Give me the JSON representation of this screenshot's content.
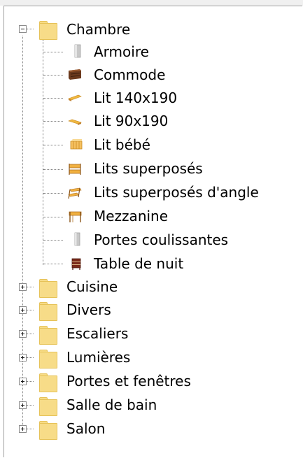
{
  "tree": {
    "root": {
      "label": "Chambre",
      "expanded": true,
      "children": [
        {
          "label": "Armoire",
          "icon": "armoire-icon"
        },
        {
          "label": "Commode",
          "icon": "commode-icon"
        },
        {
          "label": "Lit 140x190",
          "icon": "bed-icon"
        },
        {
          "label": "Lit 90x190",
          "icon": "bed-icon"
        },
        {
          "label": "Lit bébé",
          "icon": "crib-icon"
        },
        {
          "label": "Lits superposés",
          "icon": "bunk-bed-icon"
        },
        {
          "label": "Lits superposés d'angle",
          "icon": "corner-bunk-bed-icon"
        },
        {
          "label": "Mezzanine",
          "icon": "mezzanine-icon"
        },
        {
          "label": "Portes coulissantes",
          "icon": "sliding-door-icon"
        },
        {
          "label": "Table de nuit",
          "icon": "nightstand-icon"
        }
      ]
    },
    "categories": [
      {
        "label": "Cuisine",
        "expanded": false
      },
      {
        "label": "Divers",
        "expanded": false
      },
      {
        "label": "Escaliers",
        "expanded": false
      },
      {
        "label": "Lumières",
        "expanded": false
      },
      {
        "label": "Portes et fenêtres",
        "expanded": false
      },
      {
        "label": "Salle de bain",
        "expanded": false
      },
      {
        "label": "Salon",
        "expanded": false
      }
    ]
  },
  "colors": {
    "folder": "#f7dc88",
    "connector": "#808080",
    "background": "#ffffff"
  }
}
